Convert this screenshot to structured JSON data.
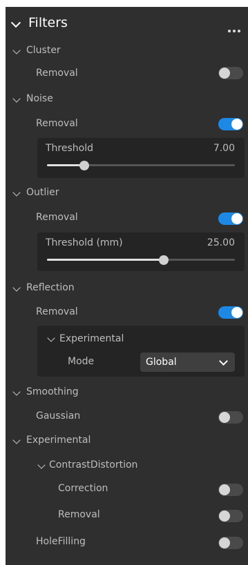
{
  "panel": {
    "title": "Filters",
    "more_icon": "more-horizontal-icon"
  },
  "sections": {
    "cluster": {
      "label": "Cluster",
      "removal_label": "Removal",
      "removal_on": false
    },
    "noise": {
      "label": "Noise",
      "removal_label": "Removal",
      "removal_on": true,
      "threshold_label": "Threshold",
      "threshold_value": "7.00",
      "threshold_fraction": 0.2
    },
    "outlier": {
      "label": "Outlier",
      "removal_label": "Removal",
      "removal_on": true,
      "threshold_label": "Threshold (mm)",
      "threshold_value": "25.00",
      "threshold_fraction": 0.62
    },
    "reflection": {
      "label": "Reflection",
      "removal_label": "Removal",
      "removal_on": true,
      "experimental_label": "Experimental",
      "mode_label": "Mode",
      "mode_value": "Global"
    },
    "smoothing": {
      "label": "Smoothing",
      "gaussian_label": "Gaussian",
      "gaussian_on": false
    },
    "experimental": {
      "label": "Experimental",
      "contrast_label": "ContrastDistortion",
      "correction_label": "Correction",
      "correction_on": false,
      "removal_label": "Removal",
      "removal_on": false,
      "holefilling_label": "HoleFilling",
      "holefilling_on": false
    }
  },
  "colors": {
    "accent": "#1e88e5",
    "panel_bg": "#2f2f2f",
    "card_bg": "#242424"
  }
}
